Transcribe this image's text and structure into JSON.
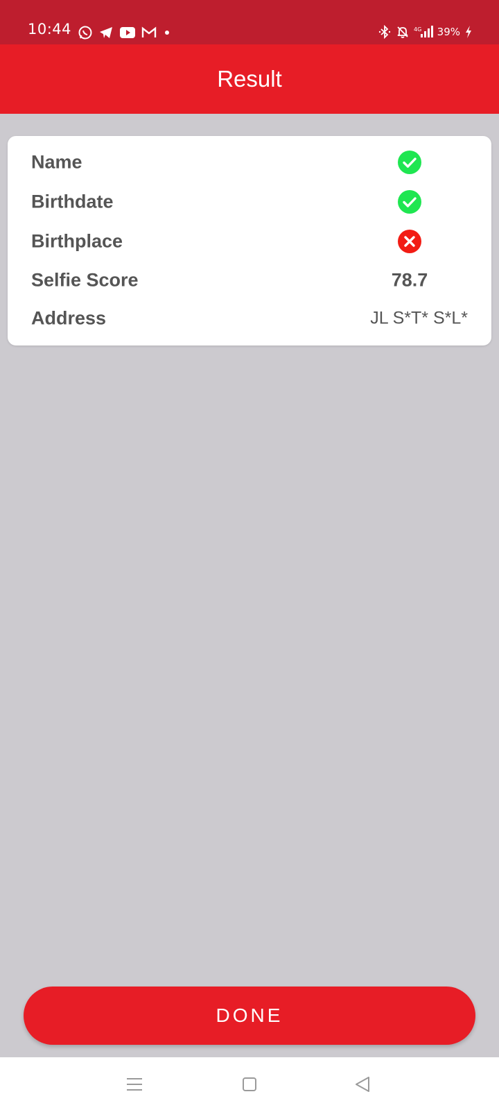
{
  "status_bar": {
    "time": "10:44",
    "left_icons": [
      "whatsapp-icon",
      "telegram-icon",
      "youtube-icon",
      "gmail-icon",
      "notification-dot-icon"
    ],
    "right_icons": [
      "bluetooth-icon",
      "mute-bell-icon",
      "signal-4g-icon",
      "charging-icon"
    ],
    "battery": "39%"
  },
  "app_bar": {
    "title": "Result"
  },
  "result": {
    "rows": [
      {
        "label": "Name",
        "status": "check",
        "status_color": "#1fe651"
      },
      {
        "label": "Birthdate",
        "status": "check",
        "status_color": "#1fe651"
      },
      {
        "label": "Birthplace",
        "status": "cross",
        "status_color": "#f21c14"
      },
      {
        "label": "Selfie Score",
        "value": "78.7"
      },
      {
        "label": "Address",
        "value": "JL S*T* S*L*"
      }
    ]
  },
  "done_button": {
    "label": "DONE"
  },
  "nav_bar": {
    "icons": [
      "menu-icon",
      "home-square-icon",
      "back-triangle-icon"
    ]
  },
  "colors": {
    "status_bar": "#be1e2e",
    "accent": "#e71d26",
    "background": "#cccacf",
    "text": "#555555"
  }
}
